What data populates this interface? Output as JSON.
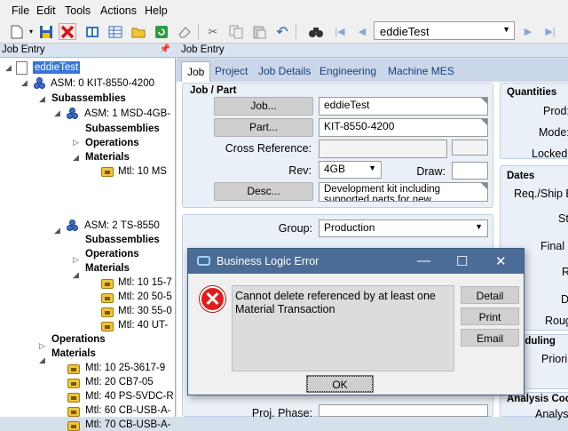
{
  "menu": [
    "File",
    "Edit",
    "Tools",
    "Actions",
    "Help"
  ],
  "toolbar": {
    "icons": [
      "new-icon",
      "save-icon",
      "delete-icon",
      "book-icon",
      "grid-icon",
      "folder-icon",
      "refresh-icon",
      "eraser-icon",
      "cut-icon",
      "copy-icon",
      "paste-icon",
      "undo-icon",
      "binoculars-icon",
      "first-icon",
      "prev-icon",
      "next-icon",
      "last-icon"
    ],
    "customer_value": "eddieTest"
  },
  "left_panel": {
    "title": "Job Entry",
    "tree": [
      {
        "text": "eddieTest",
        "kind": "root"
      },
      {
        "text": "ASM: 0 KIT-8550-4200",
        "kind": "asm"
      },
      {
        "text": "Subassemblies",
        "kind": "bold"
      },
      {
        "text": "ASM: 1 MSD-4GB-",
        "kind": "asm"
      },
      {
        "text": "Subassemblies",
        "kind": "bold"
      },
      {
        "text": "Operations",
        "kind": "bold"
      },
      {
        "text": "Materials",
        "kind": "bold"
      },
      {
        "text": "Mtl: 10 MS",
        "kind": "mtl"
      },
      {
        "text": "ASM: 2 TS-8550",
        "kind": "asm"
      },
      {
        "text": "Subassemblies",
        "kind": "bold"
      },
      {
        "text": "Operations",
        "kind": "bold"
      },
      {
        "text": "Materials",
        "kind": "bold"
      },
      {
        "text": "Mtl: 10 15-7",
        "kind": "mtl"
      },
      {
        "text": "Mtl: 20 50-5",
        "kind": "mtl"
      },
      {
        "text": "Mtl: 30 55-0",
        "kind": "mtl"
      },
      {
        "text": "Mtl: 40 UT-",
        "kind": "mtl"
      },
      {
        "text": "Operations",
        "kind": "bold"
      },
      {
        "text": "Materials",
        "kind": "bold"
      },
      {
        "text": "Mtl: 10 25-3617-9",
        "kind": "mtl"
      },
      {
        "text": "Mtl: 20 CB7-05",
        "kind": "mtl"
      },
      {
        "text": "Mtl: 40 PS-5VDC-R",
        "kind": "mtl"
      },
      {
        "text": "Mtl: 60 CB-USB-A-",
        "kind": "mtl"
      },
      {
        "text": "Mtl: 70 CB-USB-A-",
        "kind": "mtl"
      }
    ]
  },
  "main": {
    "title": "Job Entry",
    "tabs": [
      "Job",
      "Project",
      "Job Details",
      "Engineering",
      "Machine MES"
    ],
    "job_part": {
      "section": "Job / Part",
      "job_button": "Job...",
      "job_value": "eddieTest",
      "part_button": "Part...",
      "part_value": "KIT-8550-4200",
      "cross_ref_label": "Cross Reference:",
      "rev_label": "Rev:",
      "rev_value": "4GB",
      "draw_label": "Draw:",
      "desc_button": "Desc...",
      "desc_value": "Development kit including supported parts for new developme"
    },
    "group_label": "Group:",
    "group_value": "Production",
    "proj_phase_label": "Proj. Phase:",
    "right_column": {
      "quantities_head": "Quantities",
      "prod_label": "Prod:",
      "mode_label": "Mode:",
      "locked_label": "Locked:",
      "dates_head": "Dates",
      "reqship_label": "Req./Ship E",
      "st_label": "St",
      "final_label": "Final (",
      "r_label": "R",
      "d_label": "D",
      "roug_label": "Roug",
      "sched_head": "eduling",
      "priori_label": "Priori",
      "analysis_head": "Analysis Cod",
      "analys_label": "Analys"
    }
  },
  "dialog": {
    "title": "Business Logic Error",
    "message": "Cannot delete referenced by at least one Material Transaction",
    "buttons": [
      "Detail",
      "Print",
      "Email"
    ],
    "ok": "OK"
  }
}
